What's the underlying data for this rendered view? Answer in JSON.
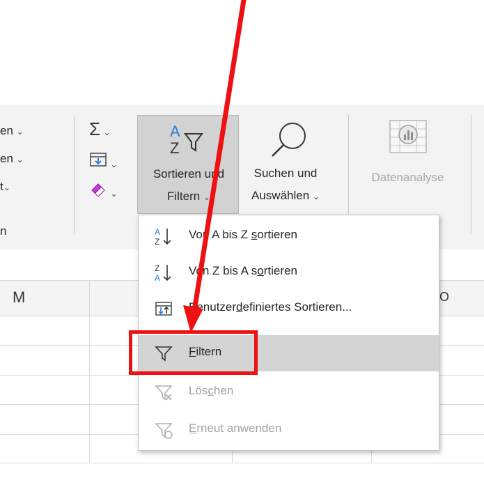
{
  "ribbon": {
    "left_items": [
      "en",
      "en",
      "t"
    ],
    "left_group_label": "n",
    "sort_filter": {
      "line1": "Sortieren und",
      "line2": "Filtern"
    },
    "find_select": {
      "line1": "Suchen und",
      "line2": "Auswählen"
    },
    "data_analysis": {
      "label": "Datenanalyse"
    }
  },
  "sheet": {
    "col_header_left": "M",
    "col_header_right": "O"
  },
  "menu": {
    "items": [
      {
        "pre": "Von A bis Z ",
        "ul": "s",
        "post": "ortieren",
        "icon": "sort-az-icon",
        "disabled": false
      },
      {
        "pre": "Von Z bis A s",
        "ul": "o",
        "post": "rtieren",
        "icon": "sort-za-icon",
        "disabled": false
      },
      {
        "pre": "Benutzer",
        "ul": "d",
        "post": "efiniertes Sortieren...",
        "icon": "custom-sort-icon",
        "disabled": false
      },
      {
        "pre": "",
        "ul": "F",
        "post": "iltern",
        "icon": "filter-icon",
        "disabled": false,
        "highlighted": true
      },
      {
        "pre": "Lös",
        "ul": "c",
        "post": "hen",
        "icon": "clear-filter-icon",
        "disabled": true
      },
      {
        "pre": "",
        "ul": "E",
        "post": "rneut anwenden",
        "icon": "reapply-filter-icon",
        "disabled": true
      }
    ]
  },
  "colors": {
    "annotation_red": "#ee1111",
    "accent_blue": "#2b7cd3",
    "highlight": "#d4d4d4"
  }
}
